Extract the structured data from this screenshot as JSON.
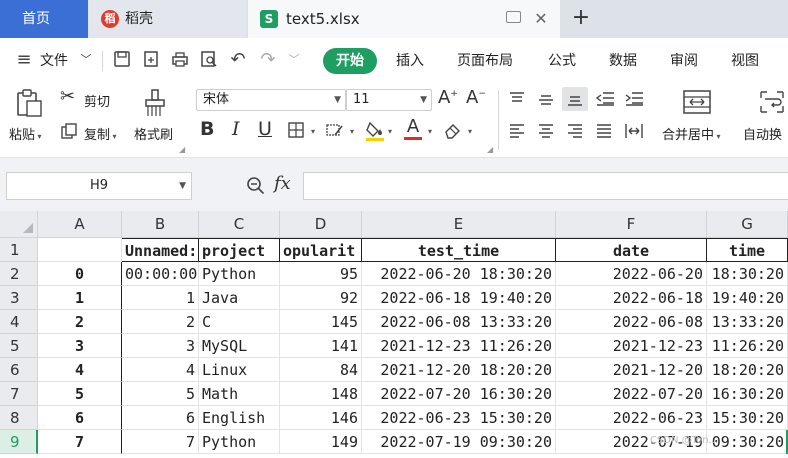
{
  "tabs": {
    "home": "首页",
    "docer": "稻壳",
    "file": "text5.xlsx"
  },
  "menu": {
    "file": "文件",
    "start": "开始",
    "insert": "插入",
    "page_layout": "页面布局",
    "formula": "公式",
    "data": "数据",
    "review": "审阅",
    "view": "视图"
  },
  "ribbon": {
    "paste": "粘贴",
    "cut": "剪切",
    "copy": "复制",
    "format_painter": "格式刷",
    "font_name": "宋体",
    "font_size": "11",
    "merge_center": "合并居中",
    "auto_wrap": "自动换"
  },
  "formula_bar": {
    "name_box": "H9",
    "fx": "fx",
    "value": ""
  },
  "columns": [
    "A",
    "B",
    "C",
    "D",
    "E",
    "F",
    "G"
  ],
  "row_numbers": [
    "1",
    "2",
    "3",
    "4",
    "5",
    "6",
    "7",
    "8",
    "9"
  ],
  "header_row": {
    "b": "Unnamed:",
    "c": "project",
    "d": "opularit",
    "e": "test_time",
    "f": "date",
    "g": "time"
  },
  "rows": [
    {
      "a": "0",
      "b": "00:00:00",
      "c": "Python",
      "d": "95",
      "e": "2022-06-20 18:30:20",
      "f": "2022-06-20",
      "g": "18:30:20"
    },
    {
      "a": "1",
      "b": "1",
      "c": "Java",
      "d": "92",
      "e": "2022-06-18 19:40:20",
      "f": "2022-06-18",
      "g": "19:40:20"
    },
    {
      "a": "2",
      "b": "2",
      "c": "C",
      "d": "145",
      "e": "2022-06-08 13:33:20",
      "f": "2022-06-08",
      "g": "13:33:20"
    },
    {
      "a": "3",
      "b": "3",
      "c": "MySQL",
      "d": "141",
      "e": "2021-12-23 11:26:20",
      "f": "2021-12-23",
      "g": "11:26:20"
    },
    {
      "a": "4",
      "b": "4",
      "c": "Linux",
      "d": "84",
      "e": "2021-12-20 18:20:20",
      "f": "2021-12-20",
      "g": "18:20:20"
    },
    {
      "a": "5",
      "b": "5",
      "c": "Math",
      "d": "148",
      "e": "2022-07-20 16:30:20",
      "f": "2022-07-20",
      "g": "16:30:20"
    },
    {
      "a": "6",
      "b": "6",
      "c": "English",
      "d": "146",
      "e": "2022-06-23 15:30:20",
      "f": "2022-06-23",
      "g": "15:30:20"
    },
    {
      "a": "7",
      "b": "7",
      "c": "Python",
      "d": "149",
      "e": "2022-07-19 09:30:20",
      "f": "2022-07-19",
      "g": "09:30:20"
    }
  ],
  "selected_row": "9",
  "watermark": "CSDN @Ton..."
}
